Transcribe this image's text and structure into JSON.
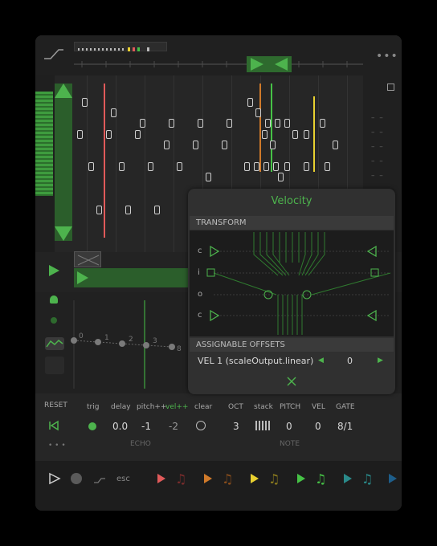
{
  "popup": {
    "title": "Velocity",
    "transform_header": "TRANSFORM",
    "rows": [
      "c",
      "i",
      "o",
      "c"
    ],
    "offsets_header": "ASSIGNABLE OFFSETS",
    "offset_label": "VEL 1 (scaleOutput.linear)",
    "offset_value": "0"
  },
  "echo": {
    "labels": [
      "trig",
      "delay",
      "pitch++",
      "vel++",
      "clear"
    ],
    "values": [
      "0.0",
      "-1",
      "-2"
    ],
    "group_label": "ECHO"
  },
  "note": {
    "labels": [
      "OCT",
      "stack",
      "PITCH",
      "VEL",
      "GATE"
    ],
    "values": [
      "3",
      "0",
      "0",
      "8/1"
    ],
    "group_label": "NOTE"
  },
  "reset_label": "RESET",
  "esc_label": "esc",
  "step_labels": [
    "0",
    "1",
    "2",
    "3",
    "8"
  ],
  "colors": {
    "accent": "#4db34d",
    "track_colors": [
      "#e05a5a",
      "#d07a2a",
      "#e8d030",
      "#46c246",
      "#2a8a8a"
    ]
  }
}
